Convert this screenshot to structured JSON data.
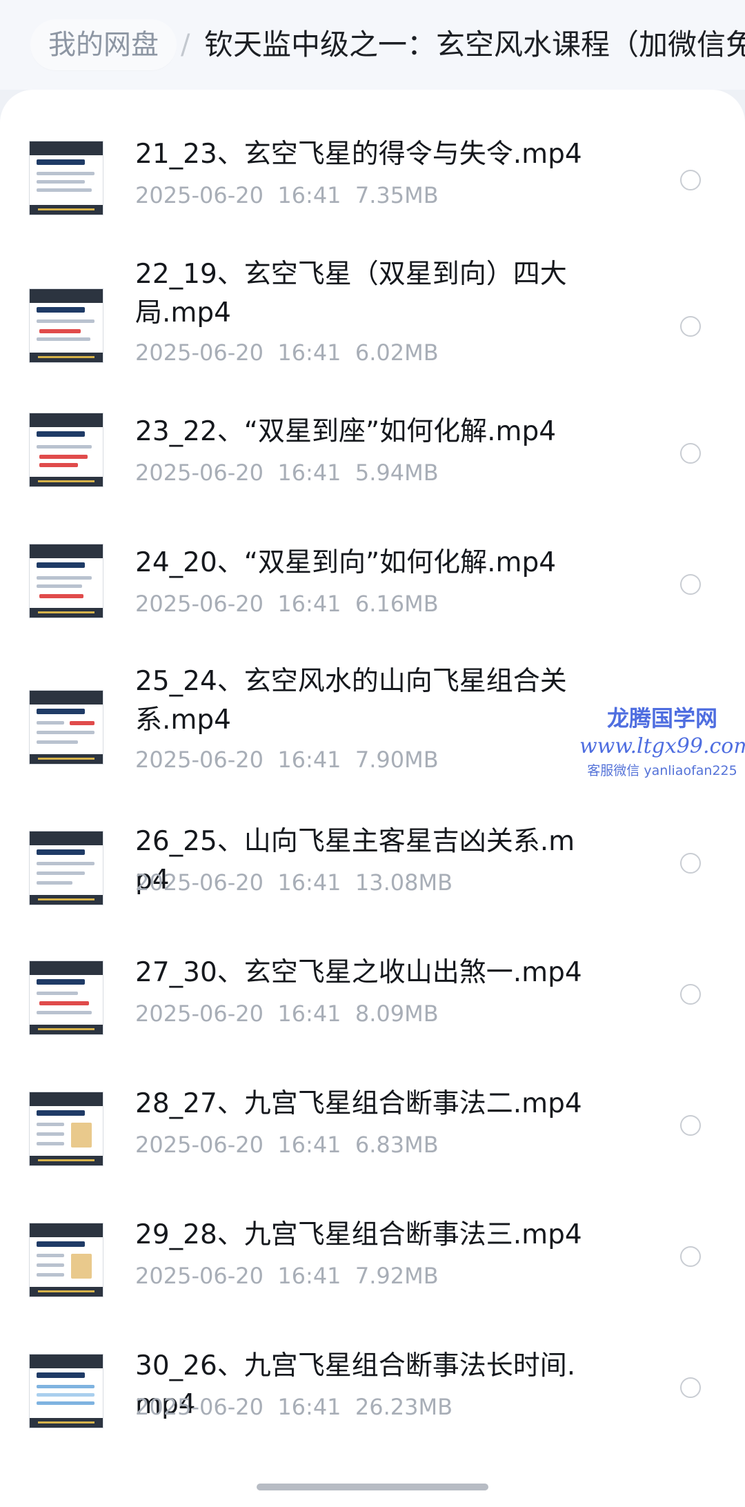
{
  "breadcrumb": {
    "root": "我的网盘",
    "separator": "/",
    "current": "钦天监中级之一：玄空风水课程（加微信免费领"
  },
  "files": [
    {
      "name": "21_23、玄空飞星的得令与失令.mp4",
      "date": "2025-06-20",
      "time": "16:41",
      "size": "7.35MB"
    },
    {
      "name": "22_19、玄空飞星（双星到向）四大局.mp4",
      "date": "2025-06-20",
      "time": "16:41",
      "size": "6.02MB"
    },
    {
      "name": "23_22、“双星到座”如何化解.mp4",
      "date": "2025-06-20",
      "time": "16:41",
      "size": "5.94MB"
    },
    {
      "name": "24_20、“双星到向”如何化解.mp4",
      "date": "2025-06-20",
      "time": "16:41",
      "size": "6.16MB"
    },
    {
      "name": "25_24、玄空风水的山向飞星组合关系.mp4",
      "date": "2025-06-20",
      "time": "16:41",
      "size": "7.90MB"
    },
    {
      "name": "26_25、山向飞星主客星吉凶关系.mp4",
      "date": "2025-06-20",
      "time": "16:41",
      "size": "13.08MB"
    },
    {
      "name": "27_30、玄空飞星之收山出煞一.mp4",
      "date": "2025-06-20",
      "time": "16:41",
      "size": "8.09MB"
    },
    {
      "name": "28_27、九宫飞星组合断事法二.mp4",
      "date": "2025-06-20",
      "time": "16:41",
      "size": "6.83MB"
    },
    {
      "name": "29_28、九宫飞星组合断事法三.mp4",
      "date": "2025-06-20",
      "time": "16:41",
      "size": "7.92MB"
    },
    {
      "name": "30_26、九宫飞星组合断事法长时间.mp4",
      "date": "2025-06-20",
      "time": "16:41",
      "size": "26.23MB"
    }
  ],
  "watermark": {
    "brand": "龙腾国学网",
    "site": "www.ltgx99.com",
    "contact": "客服微信 yanliaofan225"
  },
  "colors": {
    "background": "#eef1f6",
    "panel": "#ffffff",
    "text_primary": "#15181d",
    "text_secondary": "#a8aeb7",
    "watermark": "#4f6ee0"
  }
}
